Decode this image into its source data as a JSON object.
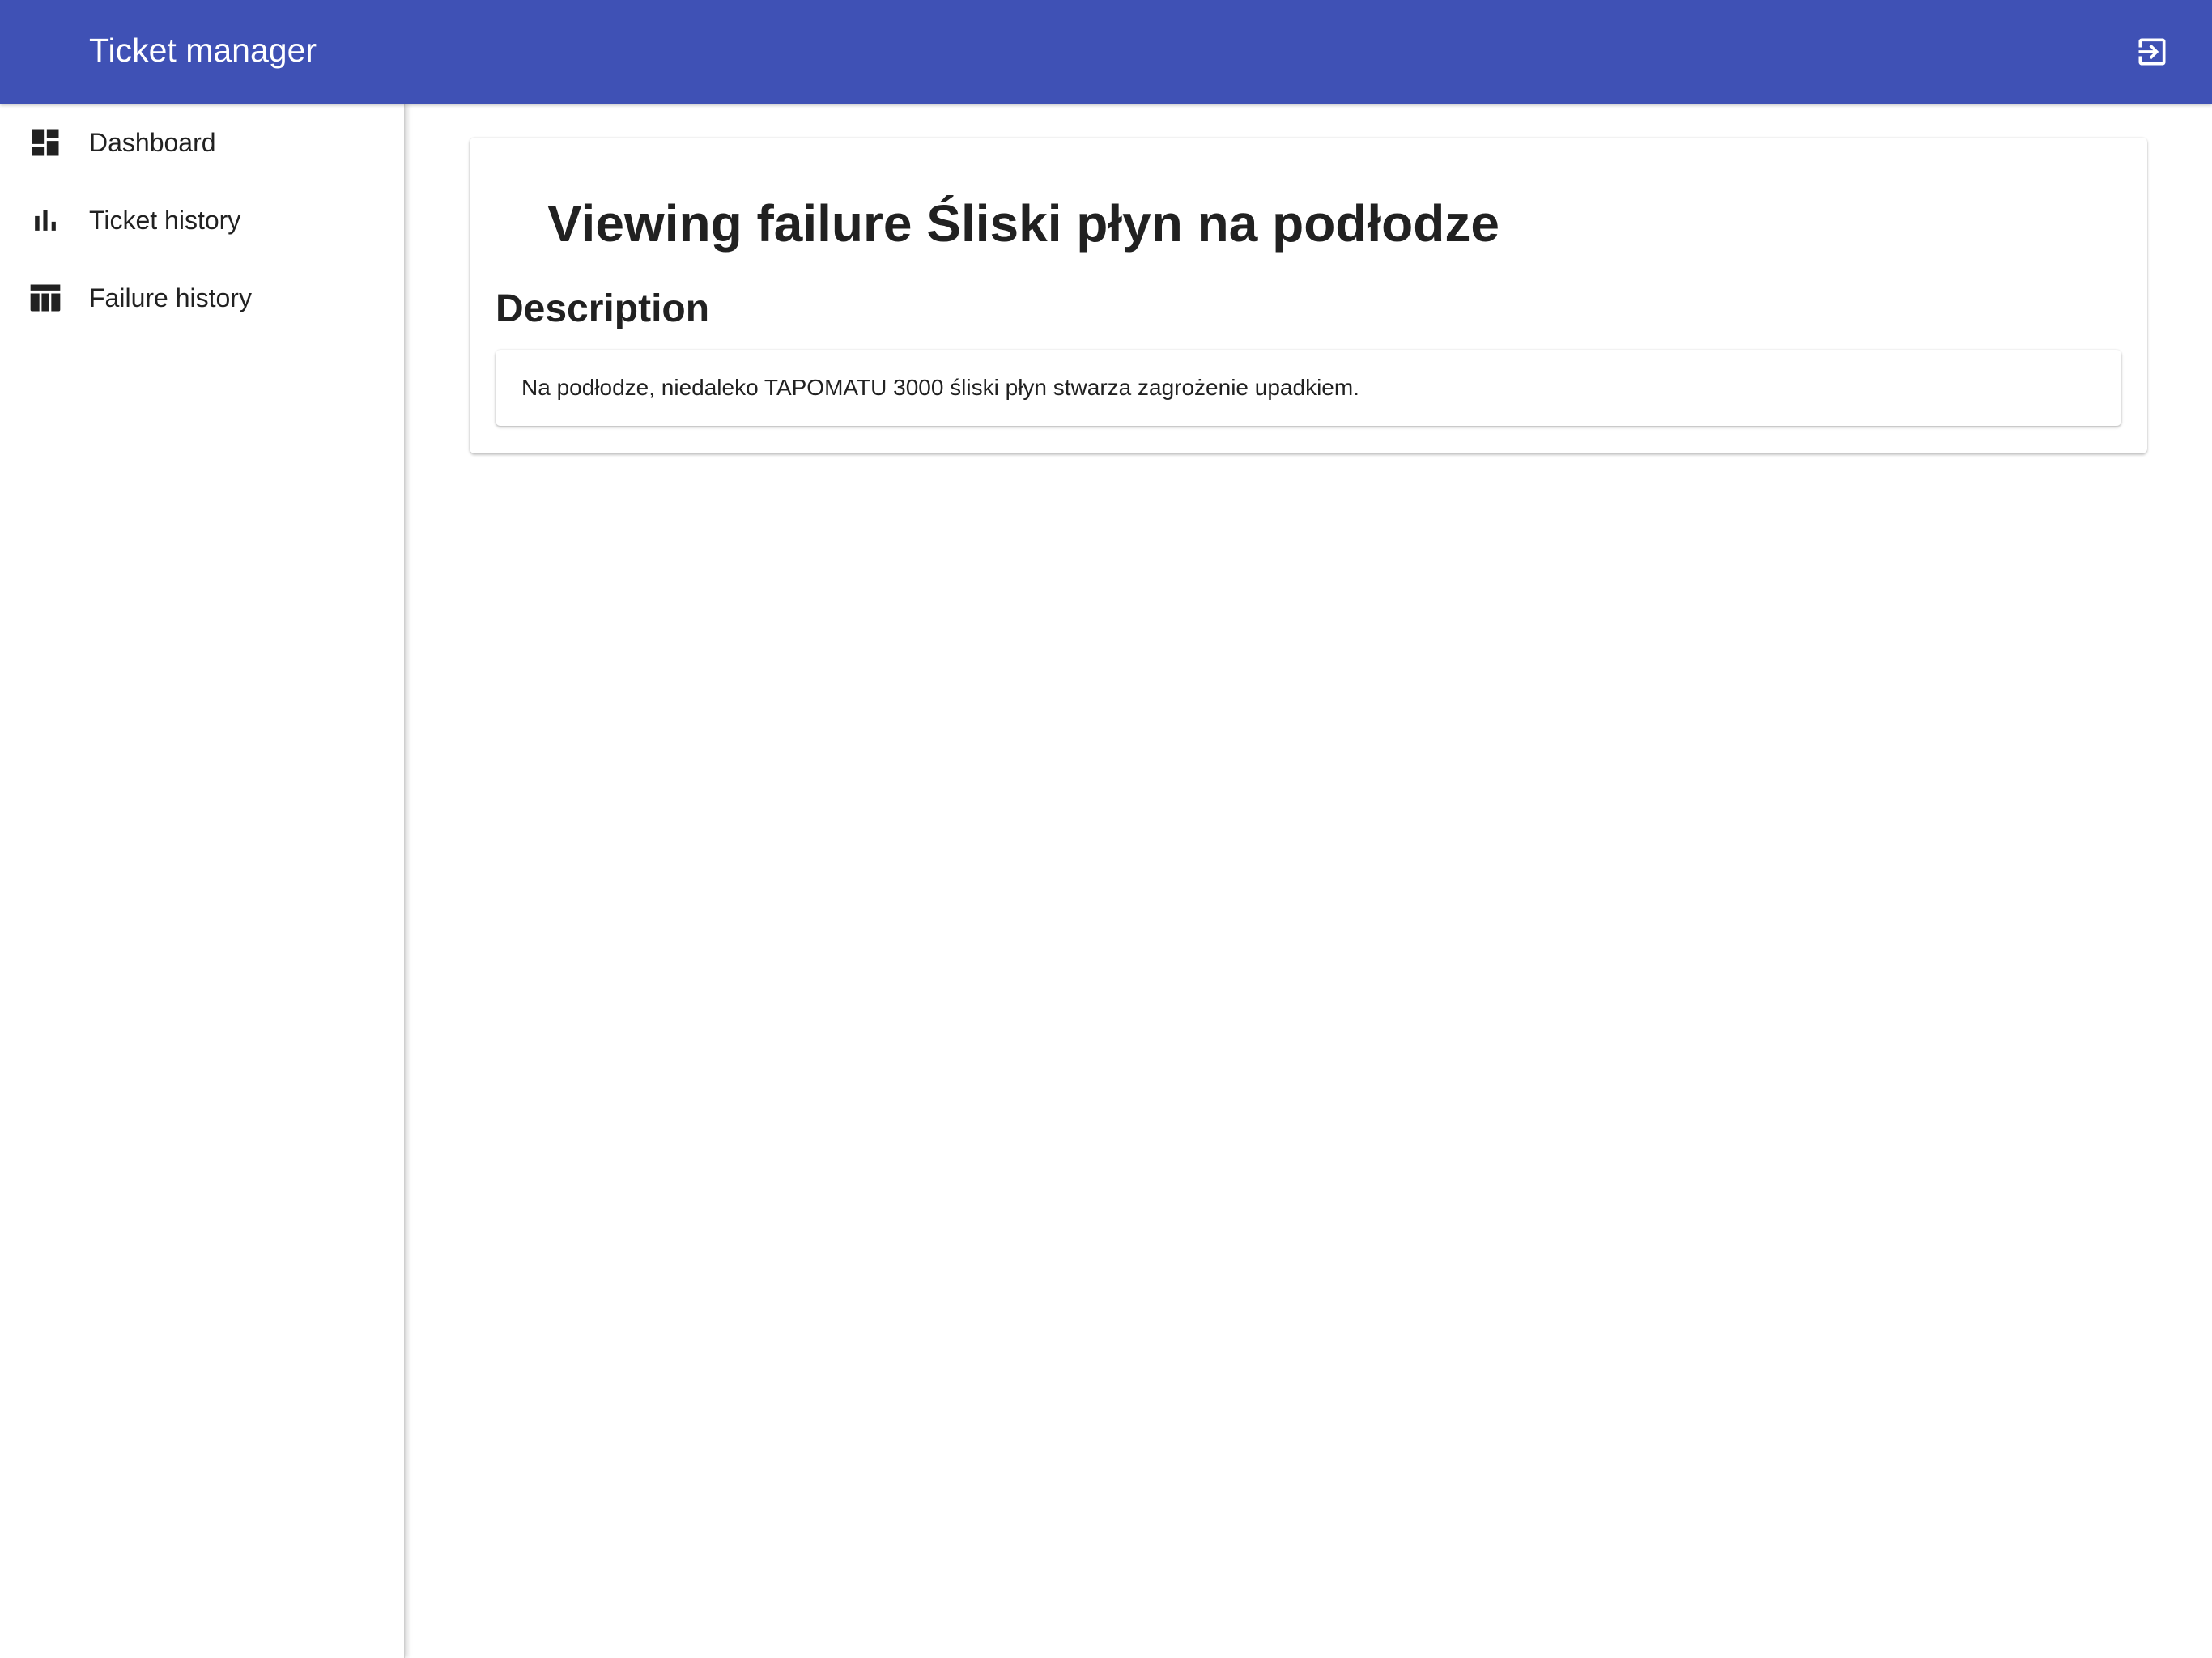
{
  "appbar": {
    "title": "Ticket manager",
    "logout_icon": "logout-icon",
    "background": "#3f51b5"
  },
  "sidebar": {
    "items": [
      {
        "label": "Dashboard",
        "icon": "dashboard-icon"
      },
      {
        "label": "Ticket history",
        "icon": "bar-chart-icon"
      },
      {
        "label": "Failure history",
        "icon": "table-icon"
      }
    ]
  },
  "failure": {
    "title": "Viewing failure Śliski płyn na podłodze",
    "description_heading": "Description",
    "description": "Na podłodze, niedaleko TAPOMATU 3000 śliski płyn stwarza zagrożenie upadkiem."
  }
}
